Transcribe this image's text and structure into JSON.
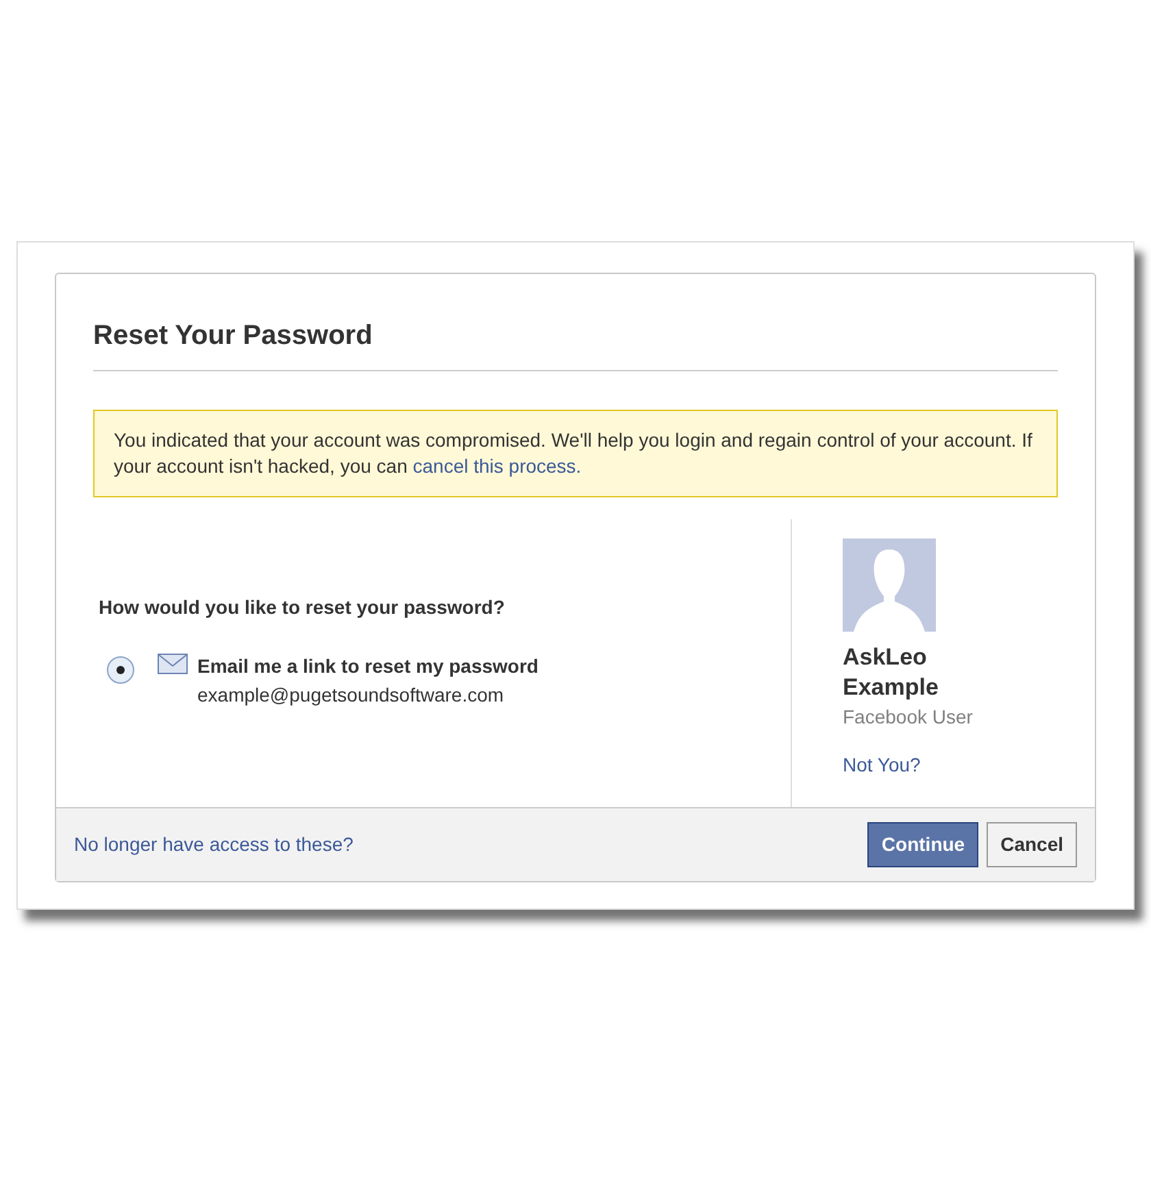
{
  "dialog": {
    "title": "Reset Your Password"
  },
  "notice": {
    "text": "You indicated that your account was compromised. We'll help you login and regain control of your account. If your account isn't hacked, you can ",
    "link": "cancel this process."
  },
  "question": "How would you like to reset your password?",
  "options": [
    {
      "label": "Email me a link to reset my password",
      "detail": "example@pugetsoundsoftware.com",
      "selected": true
    }
  ],
  "profile": {
    "name": "AskLeo Example",
    "subtitle": "Facebook User",
    "link": "Not You?"
  },
  "footer": {
    "link": "No longer have access to these?",
    "buttons": [
      {
        "label": "Continue",
        "kind": "primary"
      },
      {
        "label": "Cancel",
        "kind": "secondary"
      }
    ]
  }
}
